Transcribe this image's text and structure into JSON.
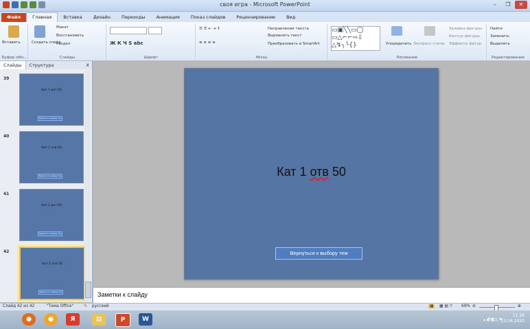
{
  "window": {
    "title": "своя игра - Microsoft PowerPoint",
    "controls": [
      "–",
      "❐",
      "✕"
    ]
  },
  "ribbon_tabs": [
    "Файл",
    "Главная",
    "Вставка",
    "Дизайн",
    "Переходы",
    "Анимация",
    "Показ слайдов",
    "Рецензирование",
    "Вид"
  ],
  "ribbon": {
    "clipboard": {
      "paste": "Вставить",
      "group": "Буфер обм..."
    },
    "slides": {
      "new_slide": "Создать слайд",
      "layout": "Макет",
      "reset": "Восстановить",
      "section": "Раздел",
      "group": "Слайды"
    },
    "font": {
      "group": "Шрифт"
    },
    "paragraph": {
      "direction": "Направление текста",
      "align": "Выровнять текст",
      "smartart": "Преобразовать в SmartArt",
      "group": "Абзац"
    },
    "drawing": {
      "arrange": "Упорядочить",
      "quick_styles": "Экспресс-стили",
      "fill": "Заливка фигуры",
      "outline": "Контур фигуры",
      "effects": "Эффекты фигур",
      "group": "Рисование"
    },
    "editing": {
      "find": "Найти",
      "replace": "Заменить",
      "select": "Выделить",
      "group": "Редактирование"
    }
  },
  "panel": {
    "tabs": [
      "Слайды",
      "Структура"
    ],
    "close": "x",
    "thumbnails": [
      {
        "number": "39",
        "title": "Кат 1 вот 50",
        "button": "Вернуться к выбору тем"
      },
      {
        "number": "40",
        "title": "Кат 1 отв 50",
        "button": "Вернуться к выбору тем"
      },
      {
        "number": "41",
        "title": "Кат 1 вот 50",
        "button": "Вернуться к выбору тем"
      },
      {
        "number": "42",
        "title": "Кат 1 отв 50",
        "button": "Вернуться к выбору тем"
      }
    ]
  },
  "slide": {
    "title_part1": "Кат 1 ",
    "title_part2": "отв",
    "title_part3": " 50",
    "button": "Вернуться к выбору тем"
  },
  "notes": {
    "placeholder": "Заметки к слайду"
  },
  "status": {
    "slide_of": "Слайд 42 из 42",
    "theme": "\"Тема Office\"",
    "language": "русский",
    "zoom": "69%"
  },
  "taskbar": {
    "lang": "РУС",
    "time": "11:16",
    "date": "23.04.2020"
  },
  "colors": {
    "slide_bg": "#5575a4",
    "button_bg": "#4f7dbf",
    "file_tab": "#c8461f",
    "selection": "#f0c44a"
  }
}
